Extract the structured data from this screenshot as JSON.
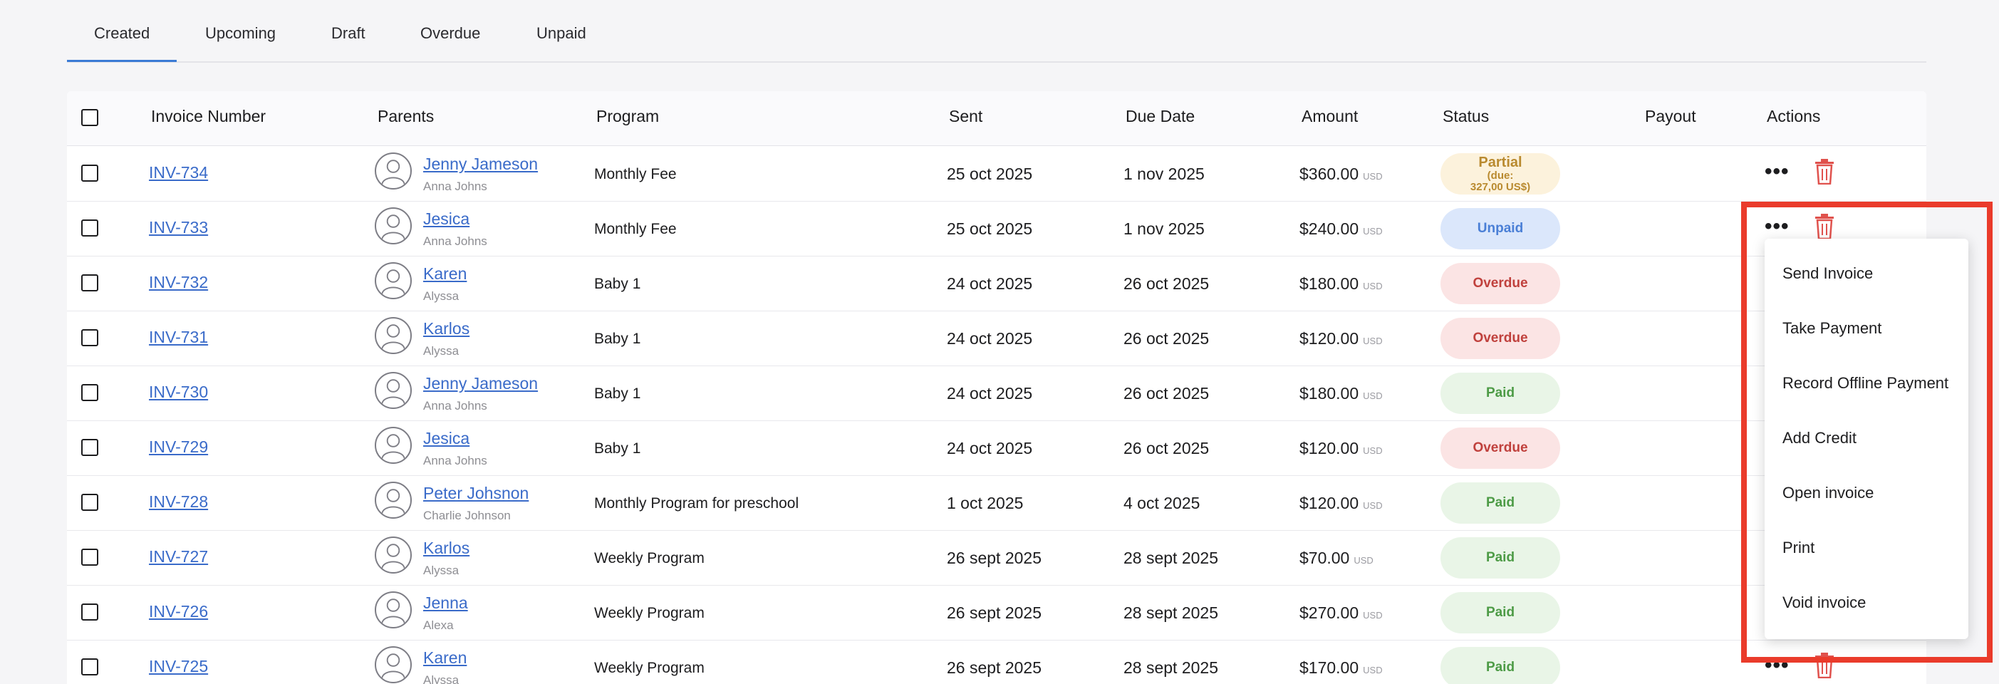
{
  "tabs": [
    "Created",
    "Upcoming",
    "Draft",
    "Overdue",
    "Unpaid"
  ],
  "active_tab": "Created",
  "columns": {
    "invoice_number": "Invoice Number",
    "parents": "Parents",
    "program": "Program",
    "sent": "Sent",
    "due_date": "Due Date",
    "amount": "Amount",
    "status": "Status",
    "payout": "Payout",
    "actions": "Actions"
  },
  "currency_label": "USD",
  "rows": [
    {
      "invoice": "INV-734",
      "parent": "Jenny Jameson",
      "child": "Anna Johns",
      "program": "Monthly Fee",
      "sent": "25 oct 2025",
      "due": "1 nov 2025",
      "amount": "$360.00",
      "status": "Partial",
      "status_type": "partial",
      "status_note": "(due:",
      "status_note2": "327,00 US$)"
    },
    {
      "invoice": "INV-733",
      "parent": "Jesica",
      "child": "Anna Johns",
      "program": "Monthly Fee",
      "sent": "25 oct 2025",
      "due": "1 nov 2025",
      "amount": "$240.00",
      "status": "Unpaid",
      "status_type": "unpaid"
    },
    {
      "invoice": "INV-732",
      "parent": "Karen",
      "child": "Alyssa",
      "program": "Baby 1",
      "sent": "24 oct 2025",
      "due": "26 oct 2025",
      "amount": "$180.00",
      "status": "Overdue",
      "status_type": "overdue"
    },
    {
      "invoice": "INV-731",
      "parent": "Karlos",
      "child": "Alyssa",
      "program": "Baby 1",
      "sent": "24 oct 2025",
      "due": "26 oct 2025",
      "amount": "$120.00",
      "status": "Overdue",
      "status_type": "overdue"
    },
    {
      "invoice": "INV-730",
      "parent": "Jenny Jameson",
      "child": "Anna Johns",
      "program": "Baby 1",
      "sent": "24 oct 2025",
      "due": "26 oct 2025",
      "amount": "$180.00",
      "status": "Paid",
      "status_type": "paid"
    },
    {
      "invoice": "INV-729",
      "parent": "Jesica",
      "child": "Anna Johns",
      "program": "Baby 1",
      "sent": "24 oct 2025",
      "due": "26 oct 2025",
      "amount": "$120.00",
      "status": "Overdue",
      "status_type": "overdue"
    },
    {
      "invoice": "INV-728",
      "parent": "Peter Johsnon",
      "child": "Charlie Johnson",
      "program": "Monthly Program for preschool",
      "sent": "1 oct 2025",
      "due": "4 oct 2025",
      "amount": "$120.00",
      "status": "Paid",
      "status_type": "paid"
    },
    {
      "invoice": "INV-727",
      "parent": "Karlos",
      "child": "Alyssa",
      "program": "Weekly Program",
      "sent": "26 sept 2025",
      "due": "28 sept 2025",
      "amount": "$70.00",
      "status": "Paid",
      "status_type": "paid"
    },
    {
      "invoice": "INV-726",
      "parent": "Jenna",
      "child": "Alexa",
      "program": "Weekly Program",
      "sent": "26 sept 2025",
      "due": "28 sept 2025",
      "amount": "$270.00",
      "status": "Paid",
      "status_type": "paid"
    },
    {
      "invoice": "INV-725",
      "parent": "Karen",
      "child": "Alyssa",
      "program": "Weekly Program",
      "sent": "26 sept 2025",
      "due": "28 sept 2025",
      "amount": "$170.00",
      "status": "Paid",
      "status_type": "paid"
    }
  ],
  "actions_menu": [
    "Send Invoice",
    "Take Payment",
    "Record Offline Payment",
    "Add Credit",
    "Open invoice",
    "Print",
    "Void invoice"
  ],
  "colors": {
    "link": "#3a6bc9",
    "tab_accent": "#3a7bd5",
    "trash": "#e0524d",
    "highlight": "#ea3b2b"
  },
  "icons": {
    "row_actions": "more-horizontal-icon",
    "delete": "trash-icon",
    "avatar": "user-avatar-icon"
  }
}
